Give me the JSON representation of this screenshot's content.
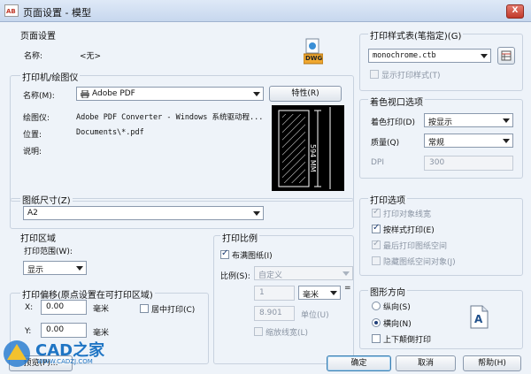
{
  "window": {
    "title": "页面设置 - 模型",
    "close_glyph": "X"
  },
  "page_setup": {
    "group_label": "页面设置",
    "name_label": "名称:",
    "name_value": "<无>",
    "dwg_icon_text": "DWG"
  },
  "printer": {
    "group_label": "打印机/绘图仪",
    "name_label": "名称(M):",
    "name_value": "Adobe PDF",
    "properties_button": "特性(R)",
    "plotter_label": "绘图仪:",
    "plotter_value": "Adobe PDF Converter - Windows 系统驱动程...",
    "location_label": "位置:",
    "location_value": "Documents\\*.pdf",
    "description_label": "说明:",
    "preview_dim_text": "594 MM"
  },
  "paper_size": {
    "group_label": "图纸尺寸(Z)",
    "value": "A2"
  },
  "plot_area": {
    "group_label": "打印区域",
    "range_label": "打印范围(W):",
    "range_value": "显示"
  },
  "plot_offset": {
    "group_label": "打印偏移(原点设置在可打印区域)",
    "x_label": "X:",
    "x_value": "0.00",
    "x_unit": "毫米",
    "y_label": "Y:",
    "y_value": "0.00",
    "y_unit": "毫米",
    "center_label": "居中打印(C)",
    "center_checked": false
  },
  "plot_scale": {
    "group_label": "打印比例",
    "fit_label": "布满图纸(I)",
    "fit_checked": true,
    "scale_label": "比例(S):",
    "scale_value": "自定义",
    "value1": "1",
    "unit1": "毫米",
    "equals": "=",
    "value2": "8.901",
    "unit2_label": "单位(U)",
    "scale_lineweights_label": "缩放线宽(L)",
    "scale_lineweights_checked": false
  },
  "plot_style_table": {
    "group_label": "打印样式表(笔指定)(G)",
    "value": "monochrome.ctb",
    "display_label": "显示打印样式(T)",
    "display_checked": false
  },
  "shaded_viewport": {
    "group_label": "着色视口选项",
    "shade_label": "着色打印(D)",
    "shade_value": "按显示",
    "quality_label": "质量(Q)",
    "quality_value": "常规",
    "dpi_label": "DPI",
    "dpi_value": "300"
  },
  "plot_options": {
    "group_label": "打印选项",
    "items": [
      {
        "label": "打印对象线宽",
        "checked": true,
        "enabled": false
      },
      {
        "label": "按样式打印(E)",
        "checked": true,
        "enabled": true
      },
      {
        "label": "最后打印图纸空间",
        "checked": true,
        "enabled": false
      },
      {
        "label": "隐藏图纸空间对象(J)",
        "checked": false,
        "enabled": false
      }
    ]
  },
  "drawing_orientation": {
    "group_label": "图形方向",
    "portrait_label": "纵向(S)",
    "portrait_checked": false,
    "landscape_label": "横向(N)",
    "landscape_checked": true,
    "upside_down_label": "上下颠倒打印",
    "upside_down_checked": false,
    "icon_letter": "A"
  },
  "footer": {
    "preview_button": "预览(P)...",
    "ok_button": "确定",
    "cancel_button": "取消",
    "help_button": "帮助(H)"
  },
  "watermark": {
    "brand": "CAD之家",
    "url": "WWW.CADZJ.COM"
  },
  "colors": {
    "accent": "#3c7fb1",
    "title_bar": "#c7d7ee",
    "dialog_bg": "#eef3f9"
  }
}
